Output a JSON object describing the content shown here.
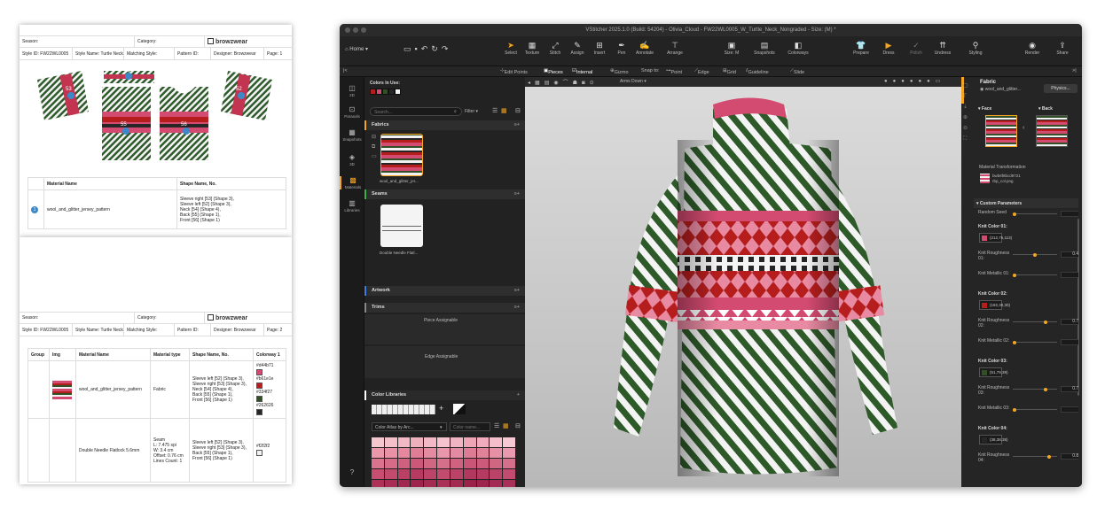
{
  "techpack": {
    "page1": {
      "season_label": "Season:",
      "category_label": "Category:",
      "brand": "browzwear",
      "style_id": "Style ID: FW22WL0005",
      "style_name": "Style Name: Turtle Neck",
      "matching_style": "Matching Style:",
      "pattern_id": "Pattern ID:",
      "designer": "Designer: Browzwear",
      "page": "Page: 1",
      "piece_labels": [
        "53",
        "54",
        "52",
        "55",
        "56"
      ],
      "table_headers": [
        "Material Name",
        "Shape Name, No."
      ],
      "rows": [
        {
          "num": "1",
          "material": "wool_and_glitter_jersey_pattern",
          "shapes": [
            "Sleeve right [53] (Shape 3),",
            "Sleeve left [52] (Shape 3),",
            "Neck [54] (Shape 4),",
            "Back [55] (Shape 1),",
            "Front [56] (Shape 1)"
          ]
        }
      ]
    },
    "page2": {
      "season_label": "Season:",
      "category_label": "Category:",
      "brand": "browzwear",
      "style_id": "Style ID: FW22WL0005",
      "style_name": "Style Name: Turtle Neck",
      "matching_style": "Matching Style:",
      "pattern_id": "Pattern ID:",
      "designer": "Designer: Browzwear",
      "page": "Page: 2",
      "table_headers": [
        "Group",
        "Img",
        "Material Name",
        "Material type",
        "Shape Name, No.",
        "Colorway 1"
      ],
      "rows": [
        {
          "material": "wool_and_glitter_jersey_pattern",
          "type": "Fabric",
          "shapes": [
            "Sleeve left [52] (Shape 3),",
            "Sleeve right [53] (Shape 3),",
            "Neck [54] (Shape 4),",
            "Back [55] (Shape 1),",
            "Front [56] (Shape 1)"
          ],
          "colors": [
            {
              "hex": "#d44b71",
              "label": "#d44b71"
            },
            {
              "hex": "#b61e1e",
              "label": "#b61e1e"
            },
            {
              "hex": "#334f27",
              "label": "#334f27"
            },
            {
              "hex": "#262626",
              "label": "#262626"
            }
          ]
        },
        {
          "material": "Double Needle Flatlock 5.6mm",
          "type_lines": [
            "Seam",
            "L: 7.475 spi",
            "W: 3.4 cm",
            "Offset: 0.76 cm",
            "Lines Count: 1"
          ],
          "shapes": [
            "Sleeve left [52] (Shape 3),",
            "Sleeve right [53] (Shape 3),",
            "Back [55] (Shape 1),",
            "Front [56] (Shape 1)"
          ],
          "colors": [
            {
              "hex": "#f2f2f2",
              "label": "#f2f2f2"
            }
          ]
        }
      ]
    }
  },
  "app": {
    "title": "VStitcher 2025.1.0 (Build: 54204) - Olivia_Cloud - FW22WL0005_W_Turtle_Neck_Nongraded - Size: (M) *",
    "home": "Home",
    "tools": [
      "Select",
      "Texture",
      "Stitch",
      "Assign",
      "Insert",
      "Pen",
      "Annotate",
      "Arrange",
      "Size: M",
      "Snapshots",
      "Colorways",
      "Prepare",
      "Dress",
      "Polish",
      "Undress",
      "Styling",
      "Render",
      "Share"
    ],
    "subbar": {
      "edit_points": "Edit Points",
      "pieces": "Pieces",
      "internal": "Internal",
      "gizmo": "Gizmo",
      "snap_to": "Snap to:",
      "point": "Point",
      "edge": "Edge",
      "grid": "Grid",
      "guideline": "Guideline",
      "slide": "Slide"
    },
    "leftnav": [
      "2D",
      "Parasols",
      "Snapshots",
      "3D",
      "Materials",
      "Libraries"
    ],
    "materials": {
      "colors_in_use": "Colors In Use:",
      "colors": [
        "#b61e1e",
        "#d44b71",
        "#334f27",
        "#262626",
        "#f2f2f2"
      ],
      "search_placeholder": "Search...",
      "filter": "Filter",
      "fabrics": "Fabrics",
      "fabric_item": "wool_and_glitter_jer...",
      "seams": "Seams",
      "seam_item": "Double Needle Flatl...",
      "artwork": "Artwork",
      "trims": "Trims",
      "piece_assignable": "Piece Assignable",
      "edge_assignable": "Edge Assignable",
      "color_libraries": "Color Libraries",
      "color_atlas": "Color Atlas by Arc...",
      "color_name_placeholder": "Color name...",
      "palette": [
        "#f4c7cf",
        "#f3c0ca",
        "#f2b9c4",
        "#efb0bd",
        "#f3b8c6",
        "#f5c3cf",
        "#f1b4c2",
        "#eea5b6",
        "#f0acbc",
        "#f4bfcb",
        "#f6cad4",
        "#e998ab",
        "#e991a6",
        "#e5879d",
        "#e07d96",
        "#e48aa1",
        "#e995aa",
        "#e38ba2",
        "#de7c95",
        "#e08399",
        "#e690a5",
        "#ea9aaf",
        "#d9738e",
        "#d66b88",
        "#d0607f",
        "#cb5878",
        "#d16683",
        "#d66f8a",
        "#cf627f",
        "#c95677",
        "#cc5a7a",
        "#d16683",
        "#d66f8c",
        "#c74e70",
        "#c24a6c",
        "#bb4065",
        "#b63a61",
        "#bd4468",
        "#c24c6e",
        "#bb4367",
        "#b3385e",
        "#b63b62",
        "#bc4368",
        "#c24b6f",
        "#ad3258",
        "#a82e56",
        "#a1284f",
        "#9d244c",
        "#a42b52",
        "#a93056",
        "#a22a51",
        "#9a224a",
        "#9d254d",
        "#a32b53",
        "#a93058"
      ],
      "view_mode": "Arms Down"
    },
    "properties": {
      "title": "Fabric",
      "fabric_name": "wool_and_glitter...",
      "physics_btn": "Physics...",
      "face": "Face",
      "back": "Back",
      "material_transformation": "Material Transformation",
      "texture_file": "bwb6f8bcd9721",
      "texture_sub": "rbp_col.png",
      "custom_parameters": "Custom Parameters",
      "params": [
        {
          "label": "Random Seed",
          "value": "0"
        },
        {
          "label": "Knit Color 01:",
          "color": "#d44b71",
          "color_label": "(212,75,113)"
        },
        {
          "label": "Knit Roughness 01:",
          "value": "0.49"
        },
        {
          "label": "Knit Metallic 01:",
          "value": "0"
        },
        {
          "label": "Knit Color 02:",
          "color": "#b61e1e",
          "color_label": "(182,30,30)"
        },
        {
          "label": "Knit Roughness 02:",
          "value": "0.75"
        },
        {
          "label": "Knit Metallic 02:",
          "value": "0"
        },
        {
          "label": "Knit Color 03:",
          "color": "#334f27",
          "color_label": "(51,79,39)"
        },
        {
          "label": "Knit Roughness 03:",
          "value": "0.75"
        },
        {
          "label": "Knit Metallic 03:",
          "value": "0"
        },
        {
          "label": "Knit Color 04:",
          "color": "#262626",
          "color_label": "(38,38,38)"
        },
        {
          "label": "Knit Roughness 04:",
          "value": "0.84"
        }
      ]
    }
  }
}
